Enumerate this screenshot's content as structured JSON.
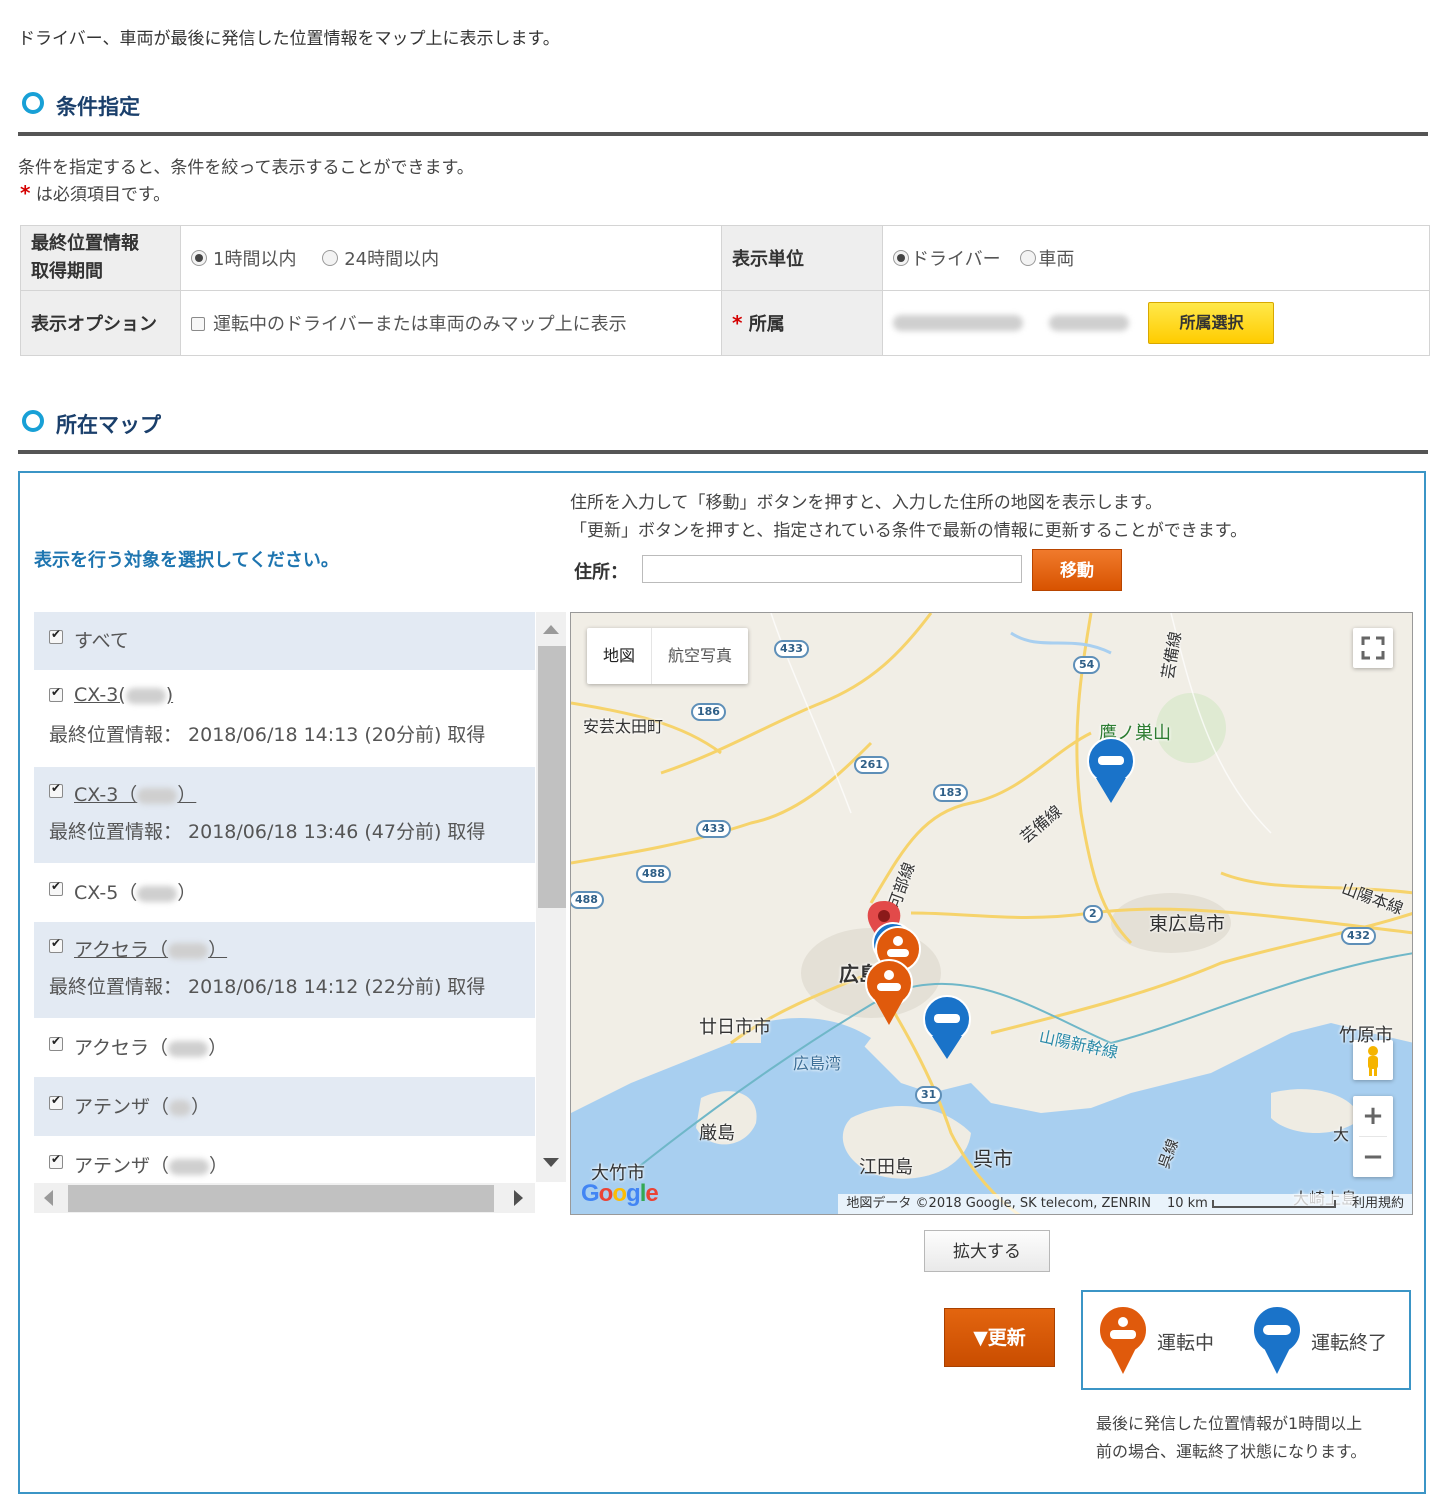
{
  "intro": "ドライバー、車両が最後に発信した位置情報をマップ上に表示します。",
  "condition": {
    "heading": "条件指定",
    "desc": "条件を指定すると、条件を絞って表示することができます。",
    "required_mark": "*",
    "required_note": "は必須項目です。",
    "period_label_1": "最終位置情報",
    "period_label_2": "取得期間",
    "period_options": [
      "1時間以内",
      "24時間以内"
    ],
    "period_selected": "1時間以内",
    "unit_label": "表示単位",
    "unit_options": [
      "ドライバー",
      "車両"
    ],
    "unit_selected": "ドライバー",
    "option_label": "表示オプション",
    "option_text": "運転中のドライバーまたは車両のみマップ上に表示",
    "affiliation_label": "所属",
    "affiliation_button": "所属選択"
  },
  "map_section": {
    "heading": "所在マップ",
    "select_label": "表示を行う対象を選択してください。",
    "help_1": "住所を入力して「移動」ボタンを押すと、入力した住所の地図を表示します。",
    "help_2": "「更新」ボタンを押すと、指定されている条件で最新の情報に更新することができます。",
    "address_label": "住所：",
    "address_value": "",
    "move_button": "移動",
    "list": [
      {
        "name": "すべて",
        "prefix": "",
        "suffix": "",
        "info": ""
      },
      {
        "name": "CX-3(",
        "suffix": ")",
        "info": "最終位置情報： 2018/06/18 14:13 (20分前) 取得"
      },
      {
        "name": "CX-3（",
        "suffix": "）",
        "info": "最終位置情報： 2018/06/18 13:46 (47分前) 取得"
      },
      {
        "name": "CX-5（",
        "suffix": "）",
        "info": ""
      },
      {
        "name": "アクセラ（",
        "suffix": "）",
        "info": "最終位置情報： 2018/06/18 14:12 (22分前) 取得"
      },
      {
        "name": "アクセラ（",
        "suffix": "）",
        "info": ""
      },
      {
        "name": "アテンザ（",
        "suffix": "）",
        "info": ""
      },
      {
        "name": "アテンザ（",
        "suffix": "）",
        "info": ""
      }
    ],
    "map": {
      "type_map": "地図",
      "type_satellite": "航空写真",
      "places": [
        "安芸太田町",
        "鷹ノ巣山",
        "芸備線",
        "芸備線",
        "可部線",
        "山陽本線",
        "東広島市",
        "広島",
        "廿日市市",
        "広島湾",
        "山陽新幹線",
        "竹原市",
        "厳島",
        "江田島",
        "呉市",
        "呉線",
        "大竹市",
        "大崎上島",
        "大"
      ],
      "roads": [
        "433",
        "54",
        "186",
        "261",
        "183",
        "433",
        "488",
        "488",
        "2",
        "432",
        "31"
      ],
      "attribution": "地図データ ©2018 Google, SK telecom, ZENRIN",
      "scale": "10 km",
      "terms": "利用規約",
      "google": "Google",
      "zoom_in": "+",
      "zoom_out": "−"
    },
    "expand_button": "拡大する",
    "update_button": "▼更新",
    "legend": {
      "driving": "運転中",
      "ended": "運転終了",
      "driving_color": "#e05a0c",
      "ended_color": "#1a73c9"
    },
    "note_1": "最後に発信した位置情報が1時間以上",
    "note_2": "前の場合、運転終了状態になります。"
  }
}
